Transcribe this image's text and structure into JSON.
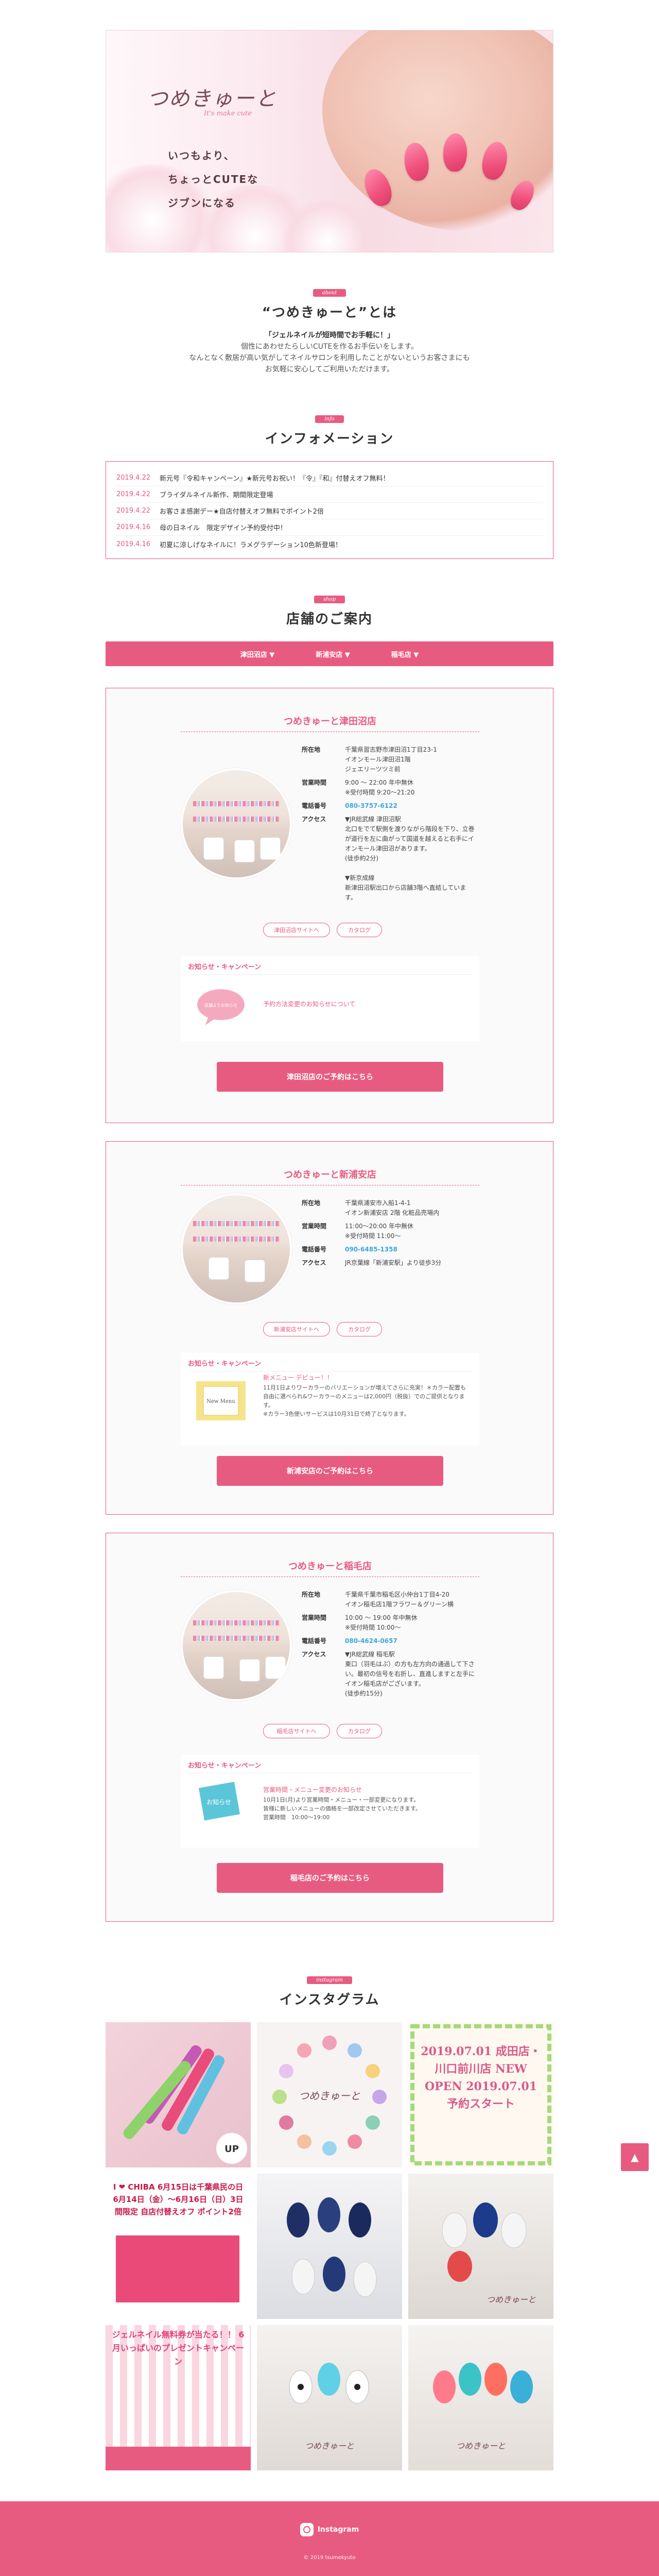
{
  "hero": {
    "logo_main": "つめきゅーと",
    "logo_sub": "It's make cute",
    "tagline": [
      "いつもより、",
      "ちょっとCUTEな",
      "ジブンになる"
    ]
  },
  "about": {
    "tag": "about",
    "title": "“つめきゅーと”とは",
    "lead": "「ジェルネイルが短時間でお手軽に！」",
    "body": [
      "個性にあわせたらしいCUTEを作るお手伝いをします。",
      "なんとなく敷居が高い気がしてネイルサロンを利用したことがないというお客さまにも",
      "お気軽に安心してご利用いただけます。"
    ]
  },
  "info": {
    "tag": "info",
    "title": "インフォメーション",
    "items": [
      {
        "date": "2019.4.22",
        "text": "新元号『令和キャンペーン』★新元号お祝い！『令』『和』付替えオフ無料！"
      },
      {
        "date": "2019.4.22",
        "text": "ブライダルネイル新作、期間限定登場"
      },
      {
        "date": "2019.4.22",
        "text": "お客さま感謝デー★自店付替えオフ無料でポイント2倍"
      },
      {
        "date": "2019.4.16",
        "text": "母の日ネイル　限定デザイン予約受付中！"
      },
      {
        "date": "2019.4.16",
        "text": "初夏に涼しげなネイルに！ラメグラデーション10色新登場！"
      }
    ]
  },
  "shops": {
    "tag": "shop",
    "title": "店舗のご案内",
    "nav": [
      "津田沼店 ▼",
      "新浦安店 ▼",
      "稲毛店 ▼"
    ],
    "labels": {
      "address": "所在地",
      "hours": "営業時間",
      "tel": "電話番号",
      "access": "アクセス",
      "news": "お知らせ・キャンペーン",
      "catalog": "カタログ"
    },
    "stores": [
      {
        "name": "つめきゅーと津田沼店",
        "address": "千葉県習志野市津田沼1丁目23-1\nイオンモール津田沼1階\nジェエリーツツミ前",
        "hours": "9:00 〜 22:00 年中無休\n※受付時間 9:20〜21:20",
        "tel": "080-3757-6122",
        "access": "▼JR総武線 津田沼駅\n北口をでて駅側を渡りながら階段を下り、立巻が道行を左に曲がって国道を越えると右手にイオンモール津田沼があります。\n(徒歩約2分)\n\n▼新京成線\n新津田沼駅出口から店舗3階へ直結しています。",
        "site": "津田沼店サイトへ",
        "news_thumb": "店舗よりお知らせ",
        "news_title": "",
        "news_text": "予約方法変更のお知らせについて",
        "reserve": "津田沼店のご予約はこちら"
      },
      {
        "name": "つめきゅーと新浦安店",
        "address": "千葉県浦安市入船1-4-1\nイオン新浦安店 2階 化粧品売場内",
        "hours": "11:00〜20:00 年中無休\n※受付時間 11:00〜",
        "tel": "090-6485-1358",
        "access": "JR京葉線「新浦安駅」より徒歩3分",
        "site": "新浦安店サイトへ",
        "news_thumb": "New Menu",
        "news_title": "新メニュー デビュー！！",
        "news_text": "11月1日よりワーカラーのバリエーションが増えてさらに充実！＊カラー配置も自由に選べられ&ワーカラーのメニューは2,000円（税抜）でのご提供となります。\n※カラー3色使いサービスは10月31日で終了となります。",
        "reserve": "新浦安店のご予約はこちら"
      },
      {
        "name": "つめきゅーと稲毛店",
        "address": "千葉県千葉市稲毛区小仲台1丁目4-20\nイオン稲毛店1階フラワー＆グリーン横",
        "hours": "10:00 〜 19:00 年中無休\n※受付時間 10:00〜",
        "tel": "080-4624-0657",
        "access": "▼JR総武線 稲毛駅\n東口（羽毛はぶ）の方も左方向の通過して下さい。最初の信号を右折し、直進しますと左手にイオン稲毛店がございます。\n(徒歩約15分)",
        "site": "稲毛店サイトへ",
        "news_thumb": "お知らせ",
        "news_title": "営業時間・メニュー変更のお知らせ",
        "news_text": "10月1日(月)より営業時間・メニュー・一部変更になります。\n皆様に新しいメニューの価格を一部改定させていただきます。\n営業時間　10:00〜19:00",
        "reserve": "稲毛店のご予約はこちら"
      }
    ]
  },
  "instagram": {
    "tag": "instagram",
    "title": "インスタグラム",
    "posts": [
      {
        "caption": "UP"
      },
      {
        "caption": "つめきゅーと"
      },
      {
        "caption": "2019.07.01 成田店・川口前川店 NEW OPEN 2019.07.01 予約スタート"
      },
      {
        "caption": "I ❤ CHIBA 6月15日は千葉県民の日 6月14日（金）〜6月16日（日）3日間限定 自店付替えオフ ポイント2倍"
      },
      {
        "caption": ""
      },
      {
        "caption": "つめきゅーと"
      },
      {
        "caption": "ジェルネイル無料券が当たる！！ 6月いっぱいのプレゼントキャンペーン"
      },
      {
        "caption": "つめきゅーと"
      },
      {
        "caption": "つめきゅーと"
      }
    ]
  },
  "footer": {
    "instagram": "Instagram",
    "copyright": "© 2019 tsumekyuto"
  },
  "pagetop": "▲",
  "colors": {
    "accent": "#e85b81",
    "link": "#3aa6e0"
  }
}
